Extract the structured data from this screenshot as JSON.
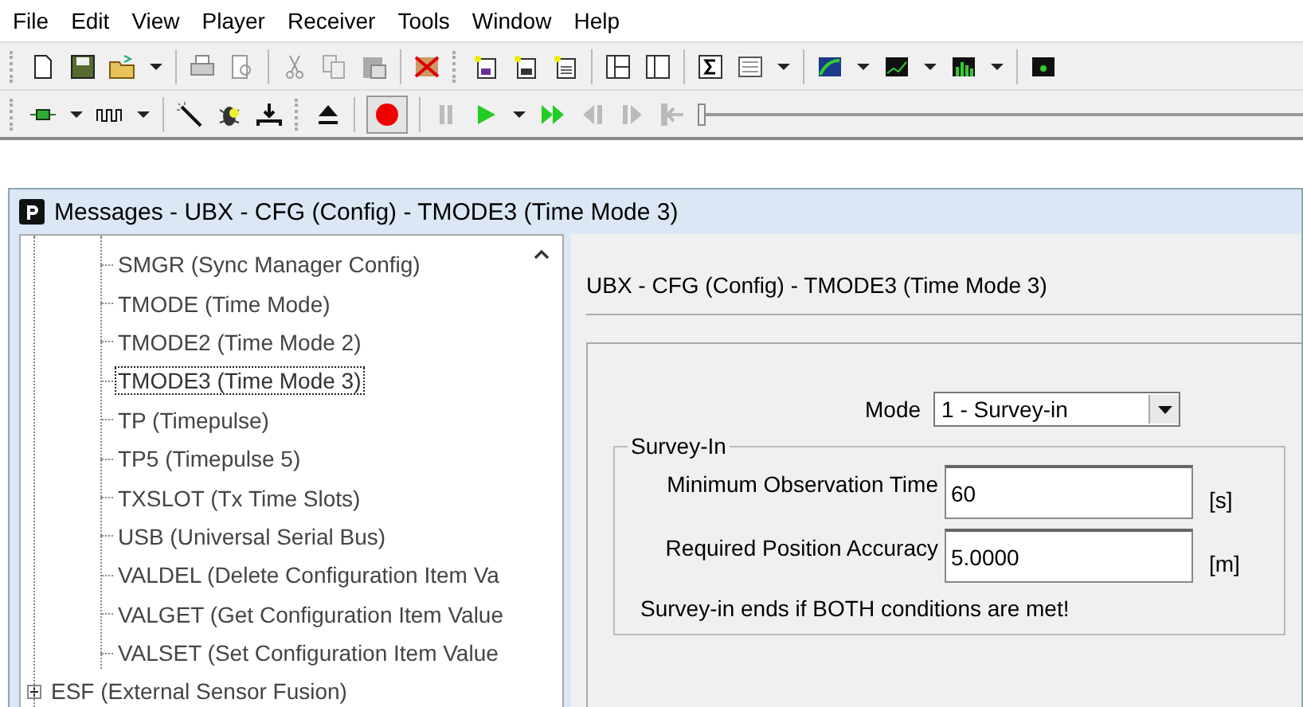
{
  "menu": [
    {
      "label": "File"
    },
    {
      "label": "Edit"
    },
    {
      "label": "View"
    },
    {
      "label": "Player"
    },
    {
      "label": "Receiver"
    },
    {
      "label": "Tools"
    },
    {
      "label": "Window"
    },
    {
      "label": "Help"
    }
  ],
  "player": {
    "record_on": true,
    "position": {
      "level": 0
    }
  },
  "window": {
    "title": "Messages - UBX - CFG (Config) - TMODE3 (Time Mode 3)"
  },
  "tree": {
    "cfg_children": [
      {
        "label": "SMGR (Sync Manager Config)",
        "selected": false
      },
      {
        "label": "TMODE (Time Mode)",
        "selected": false
      },
      {
        "label": "TMODE2 (Time Mode 2)",
        "selected": false
      },
      {
        "label": "TMODE3 (Time Mode 3)",
        "selected": true
      },
      {
        "label": "TP (Timepulse)",
        "selected": false
      },
      {
        "label": "TP5 (Timepulse 5)",
        "selected": false
      },
      {
        "label": "TXSLOT (Tx Time Slots)",
        "selected": false
      },
      {
        "label": "USB (Universal Serial Bus)",
        "selected": false
      },
      {
        "label": "VALDEL (Delete Configuration Item Va",
        "selected": false
      },
      {
        "label": "VALGET (Get Configuration Item Value",
        "selected": false
      },
      {
        "label": "VALSET (Set Configuration Item Value",
        "selected": false
      }
    ],
    "items": [
      {
        "label": "ESF (External Sensor Fusion)",
        "expanded": false,
        "selected": false
      }
    ]
  },
  "panel": {
    "heading": "UBX - CFG (Config) - TMODE3 (Time Mode 3)",
    "mode": {
      "label": "Mode",
      "value": "1 - Survey-in"
    },
    "survey_in": {
      "title": "Survey-In",
      "fields": [
        {
          "label": "Minimum Observation Time",
          "value": "60",
          "unit": "[s]"
        },
        {
          "label": "Required Position Accuracy",
          "value": "5.0000",
          "unit": "[m]"
        }
      ],
      "note": "Survey-in ends if BOTH conditions are met!"
    }
  }
}
